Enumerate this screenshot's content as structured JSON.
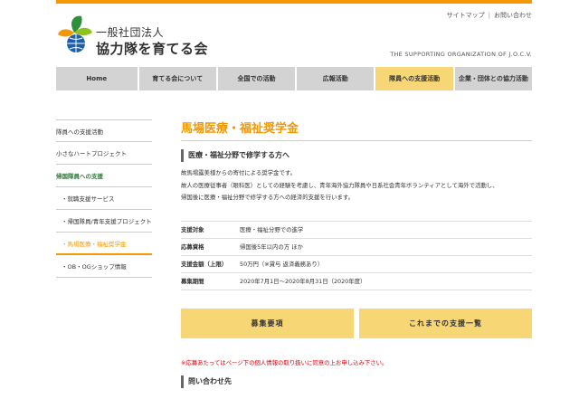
{
  "header": {
    "logo_line1": "一般社団法人",
    "logo_line2": "協力隊を育てる会",
    "util_links": [
      "サイトマップ",
      "お問い合わせ"
    ],
    "tagline": "THE SUPPORTING ORGANIZATION OF J.O.C.V."
  },
  "nav": {
    "items": [
      {
        "label": "Home"
      },
      {
        "label": "育てる会について"
      },
      {
        "label": "全国での活動"
      },
      {
        "label": "広報活動"
      },
      {
        "label": "隊員への支援活動"
      },
      {
        "label": "企業・団体との協力活動"
      }
    ],
    "active_index": 4
  },
  "sidebar": {
    "items": [
      {
        "label": "隊員への支援活動"
      },
      {
        "label": "小さなハートプロジェクト"
      },
      {
        "label": "帰国隊員への支援"
      },
      {
        "label": "・就職支援サービス"
      },
      {
        "label": "・帰国隊員/青年支援プロジェクト"
      },
      {
        "label": "・馬場医療・福祉奨学金"
      },
      {
        "label": "・OB・OGショップ情報"
      }
    ]
  },
  "main": {
    "title": "馬場医療・福祉奨学金",
    "subhead": "医療・福祉分野で修学する方へ",
    "body": [
      "故馬場露美様からの寄付による奨学金です。",
      "故人の医療従事者（眼科医）としての経験を考慮し、青年海外協力隊員や日系社会青年ボランティアとして海外で活動し、",
      "帰国後に医療・福祉分野で修学する方への経済的支援を行います。"
    ],
    "details": [
      {
        "label": "支援対象",
        "value": "医療・福祉分野での進学"
      },
      {
        "label": "応募資格",
        "value": "帰国後5年以内の方 ほか"
      },
      {
        "label": "支援金額（上限）",
        "value": "50万円（※貸与 返済義務あり）"
      },
      {
        "label": "募集期間",
        "value": "2020年7月1日～2020年8月31日（2020年度）"
      }
    ],
    "buttons": {
      "guidelines": "募集要項",
      "history": "これまでの支援一覧"
    },
    "note": "※応募あたってはページ下の個人情報の取り扱いに同意の上お申し込み下さい。",
    "inquiry_heading": "問い合わせ先"
  },
  "colors": {
    "accent": "#f39800",
    "nav_active": "#f7d775",
    "nav_default": "#d3d3d3",
    "section_green": "#2d7d3a",
    "note_red": "#d8000c"
  }
}
